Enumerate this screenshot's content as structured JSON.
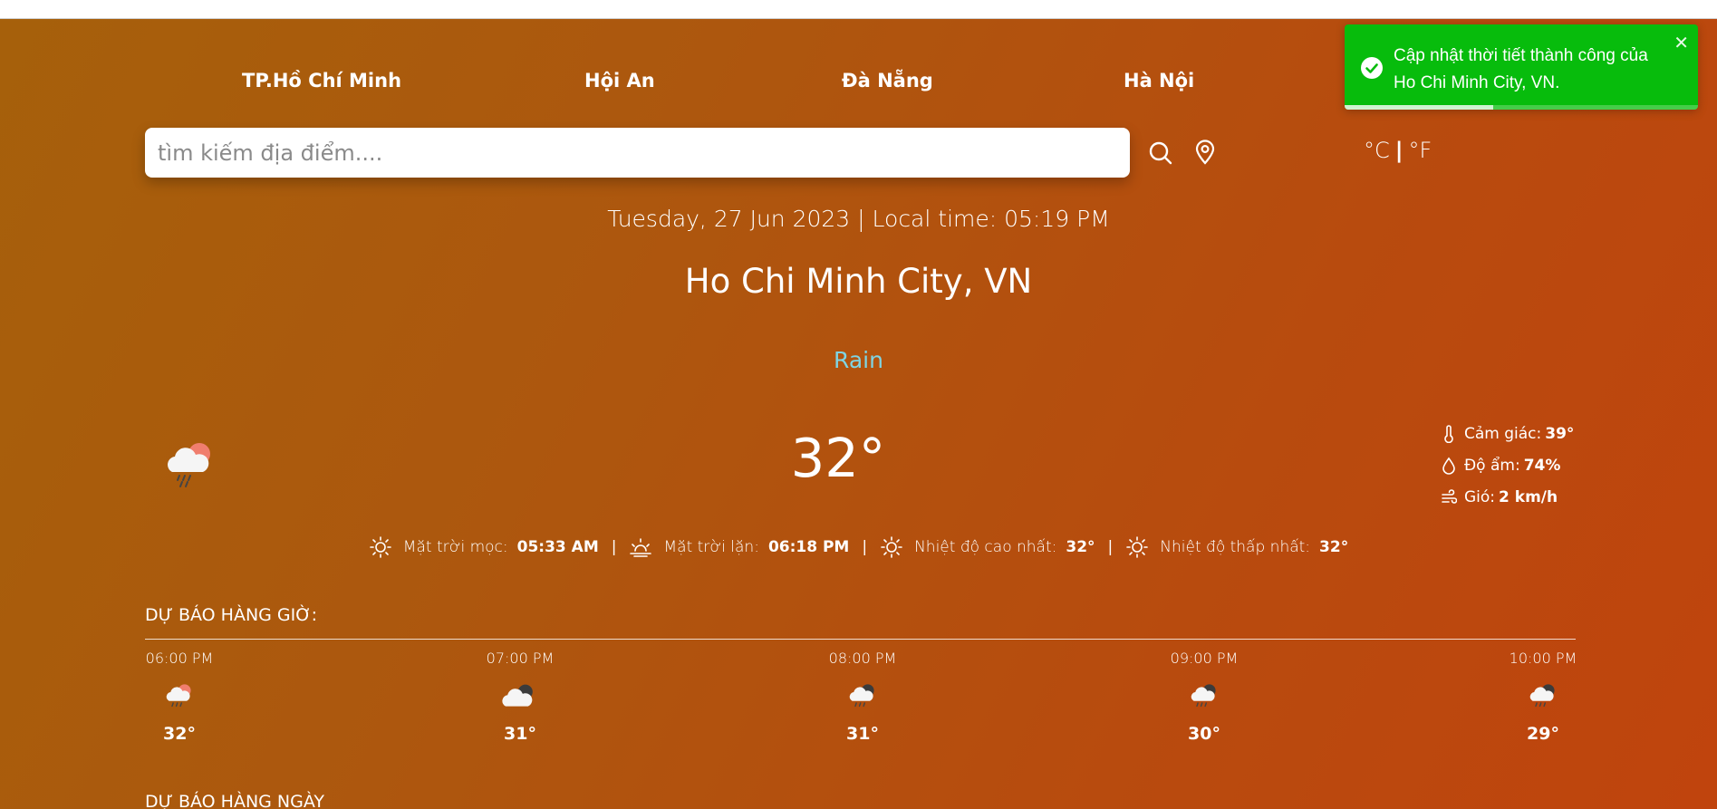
{
  "nav": {
    "cities": [
      "TP.Hồ Chí Minh",
      "Hội An",
      "Đà Nẵng",
      "Hà Nội"
    ]
  },
  "search": {
    "placeholder": "tìm kiếm địa điểm....",
    "value": ""
  },
  "units": {
    "celsius": "°C",
    "separator": "|",
    "fahrenheit": "°F"
  },
  "current": {
    "date_line": "Tuesday, 27 Jun 2023 | Local time: 05:19 PM",
    "city": "Ho Chi Minh City, VN",
    "condition": "Rain",
    "temperature": "32°",
    "condition_icon": "cloud-rain-sun-icon",
    "details": {
      "feels_like_label": "Cảm giác:",
      "feels_like_value": "39°",
      "humidity_label": "Độ ẩm:",
      "humidity_value": "74%",
      "wind_label": "Gió:",
      "wind_value": "2 km/h"
    },
    "sun": {
      "sunrise_label": "Mặt trời mọc:",
      "sunrise_value": "05:33 AM",
      "sunset_label": "Mặt trời lặn:",
      "sunset_value": "06:18 PM",
      "high_label": "Nhiệt độ cao nhất:",
      "high_value": "32°",
      "low_label": "Nhiệt độ thấp nhất:",
      "low_value": "32°",
      "separator": "|"
    }
  },
  "hourly": {
    "title": "DỰ BÁO HÀNG GIỜ:",
    "items": [
      {
        "time": "06:00 PM",
        "temp": "32°",
        "icon": "cloud-rain-sun-icon"
      },
      {
        "time": "07:00 PM",
        "temp": "31°",
        "icon": "cloud-night-icon"
      },
      {
        "time": "08:00 PM",
        "temp": "31°",
        "icon": "cloud-rain-night-icon"
      },
      {
        "time": "09:00 PM",
        "temp": "30°",
        "icon": "cloud-rain-night-icon"
      },
      {
        "time": "10:00 PM",
        "temp": "29°",
        "icon": "cloud-rain-night-icon"
      }
    ]
  },
  "daily": {
    "title": "DỰ BÁO HÀNG NGÀY"
  },
  "toast": {
    "message": "Cập nhật thời tiết thành công của Ho Chi Minh City, VN.",
    "close": "✕",
    "progress": 0.42,
    "color": "#07bc0c"
  }
}
